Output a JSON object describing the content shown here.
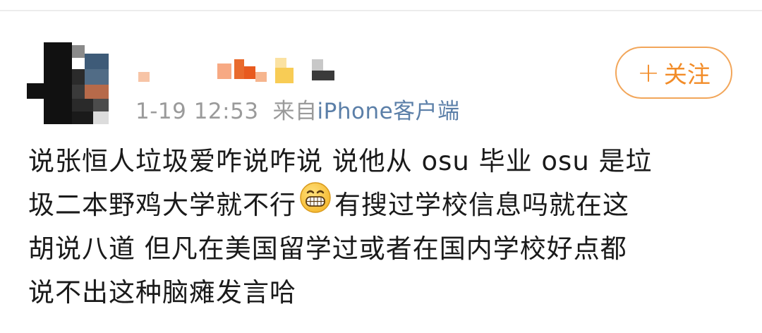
{
  "post": {
    "timestamp": "1-19 12:53",
    "source_prefix": "来自",
    "source_device": "iPhone客户端",
    "follow_label": "关注",
    "follow_icon": "+",
    "content_lines": {
      "line1": "说张恒人垃圾爱咋说咋说 说他从 osu 毕业 osu 是垃",
      "line2a": "圾二本野鸡大学就不行",
      "line2b": "有搜过学校信息吗就在这",
      "line3": "胡说八道 但凡在美国留学过或者在国内学校好点都",
      "line4": "说不出这种脑瘫发言哈"
    },
    "emoji": "grinning-face-icon"
  },
  "colors": {
    "accent": "#f28c28",
    "link": "#5b7fa8",
    "meta_text": "#9a9a9a",
    "body_text": "#1a1a1a"
  }
}
